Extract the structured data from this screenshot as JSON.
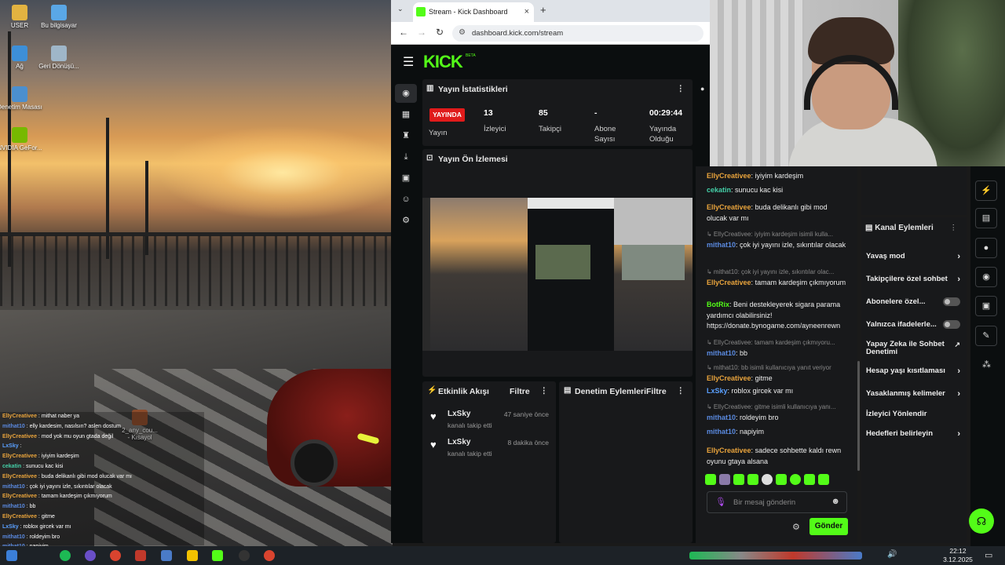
{
  "desktop": {
    "icons": [
      {
        "label": "USER",
        "color": "#e3b341"
      },
      {
        "label": "Bu bilgisayar",
        "color": "#5aa7e6"
      },
      {
        "label": "Ağ",
        "color": "#3d8fd8"
      },
      {
        "label": "Geri Dönüşü...",
        "color": "#9fb6c8"
      },
      {
        "label": "Denetim Masası",
        "color": "#4b8fcf"
      },
      {
        "label": "NVIDIA GeFor...",
        "color": "#76b900"
      }
    ],
    "shortcut": {
      "title": "2_any_cou...",
      "sub": "- Kısayol"
    }
  },
  "overlay_chat": [
    {
      "user": "ElIyCreativee",
      "text": "mithat naber ya",
      "color": "#e9a43c"
    },
    {
      "user": "mithat10",
      "text": "elly kardesim, nasılsın? aslen dostum",
      "color": "#5a8ae0"
    },
    {
      "user": "ElIyCreativee",
      "text": "mod yok mu oyun gtada değil",
      "color": "#e9a43c"
    },
    {
      "user": "LxSky",
      "text": "",
      "color": "#5aa0ff"
    },
    {
      "user": "ElIyCreativee",
      "text": "iyiyim kardeşim",
      "color": "#e9a43c"
    },
    {
      "user": "cekatin",
      "text": "sunucu kac kisi",
      "color": "#44d0a8"
    },
    {
      "user": "ElIyCreativee",
      "text": "buda delikanlı gibi mod olucak var mı",
      "color": "#e9a43c"
    },
    {
      "user": "mithat10",
      "text": "çok iyi yayını izle, sıkıntılar olacak",
      "color": "#5a8ae0"
    },
    {
      "user": "ElIyCreativee",
      "text": "tamam kardeşim çıkmıyorum",
      "color": "#e9a43c"
    },
    {
      "user": "mithat10",
      "text": "bb",
      "color": "#5a8ae0"
    },
    {
      "user": "ElIyCreativee",
      "text": "gitme",
      "color": "#e9a43c"
    },
    {
      "user": "LxSky",
      "text": "roblox gircek var mı",
      "color": "#5aa0ff"
    },
    {
      "user": "mithat10",
      "text": "roldeyim bro",
      "color": "#5a8ae0"
    },
    {
      "user": "mithat10",
      "text": "napiyim",
      "color": "#5a8ae0"
    },
    {
      "user": "ElIyCreativee",
      "text": "sadece sohbette kaldı rewn oyunu gtaya alsana",
      "color": "#e9a43c"
    }
  ],
  "browser": {
    "tab_title": "Stream - Kick Dashboard",
    "url": "dashboard.kick.com/stream",
    "logo": "KICK",
    "logo_badge": "BETA"
  },
  "stats": {
    "title": "Yayın İstatistikleri",
    "live_badge": "YAYINDA",
    "live_label": "Yayın",
    "items": [
      {
        "value": "13",
        "label": "İzleyici"
      },
      {
        "value": "85",
        "label": "Takipçi"
      },
      {
        "value": "-",
        "label": "Abone Sayısı"
      },
      {
        "value": "00:29:44",
        "label": "Yayında Olduğu"
      }
    ]
  },
  "preview": {
    "title": "Yayın Ön İzlemesi"
  },
  "activity": {
    "title": "Etkinlik Akışı",
    "filter": "Filtre",
    "events": [
      {
        "user": "LxSky",
        "action": "kanalı takip etti",
        "time": "47 saniye önce"
      },
      {
        "user": "LxSky",
        "action": "kanalı takip etti",
        "time": "8 dakika önce"
      }
    ]
  },
  "moderation": {
    "title": "Denetim Eylemleri",
    "filter": "Filtre"
  },
  "chat": {
    "messages": [
      {
        "reply": "",
        "user": "ElIyCreativee",
        "text": "iyiyim kardeşim",
        "cls": "u-elly"
      },
      {
        "reply": "",
        "user": "cekatin",
        "text": "sunucu kac kisi",
        "cls": "u-cek"
      },
      {
        "reply": "",
        "user": "ElIyCreativee",
        "text": "buda delikanlı gibi mod olucak var mı",
        "cls": "u-elly"
      },
      {
        "reply": "ElIyCreativee: iyiyim kardeşim isimli kulla...",
        "user": "mithat10",
        "text": "çok iyi yayını izle, sıkıntılar olacak",
        "cls": "u-mit"
      },
      {
        "reply": "mithat10: çok iyi yayını izle, sıkıntılar olac...",
        "user": "ElIyCreativee",
        "text": "tamam kardeşim çıkmıyorum",
        "cls": "u-elly"
      },
      {
        "reply": "",
        "user": "BotRix",
        "text": "Beni destekleyerek sigara parama yardımcı olabilirsiniz! https://donate.bynogame.com/ayneenrewn",
        "cls": "u-bot"
      },
      {
        "reply": "ElIyCreativee: tamam kardeşim çıkmıyoru...",
        "user": "mithat10",
        "text": "bb",
        "cls": "u-mit"
      },
      {
        "reply": "mithat10: bb isimli kullanıcıya yanıt veriyor",
        "user": "ElIyCreativee",
        "text": "gitme",
        "cls": "u-elly"
      },
      {
        "reply": "",
        "user": "LxSky",
        "text": "roblox gircek var mı",
        "cls": "u-lx"
      },
      {
        "reply": "ElIyCreativee: gitme isimli kullanıcıya yanı...",
        "user": "mithat10",
        "text": "roldeyim bro",
        "cls": "u-mit"
      },
      {
        "reply": "",
        "user": "mithat10",
        "text": "napiyim",
        "cls": "u-mit"
      },
      {
        "reply": "",
        "user": "ElIyCreativee",
        "text": "sadece sohbette kaldı rewn oyunu gtaya alsana",
        "cls": "u-elly"
      }
    ],
    "placeholder": "Bir mesaj gönderin",
    "send": "Gönder"
  },
  "channel_actions": {
    "title": "Kanal Eylemleri",
    "items": [
      {
        "label": "Yavaş mod",
        "control": "chevron"
      },
      {
        "label": "Takipçilere özel sohbet",
        "control": "chevron"
      },
      {
        "label": "Abonelere özel...",
        "control": "toggle"
      },
      {
        "label": "Yalnızca ifadelerle...",
        "control": "toggle"
      },
      {
        "label": "Yapay Zeka ile Sohbet Denetimi",
        "control": "external"
      },
      {
        "label": "Hesap yaşı kısıtlaması",
        "control": "chevron"
      },
      {
        "label": "Yasaklanmış kelimeler",
        "control": "chevron"
      },
      {
        "label": "İzleyici Yönlendir",
        "control": "none"
      },
      {
        "label": "Hedefleri belirleyin",
        "control": "chevron"
      }
    ]
  },
  "taskbar": {
    "time": "22:12",
    "date": "3.12.2025"
  },
  "colors": {
    "kick_green": "#53fc18",
    "live_red": "#e01b1b"
  }
}
